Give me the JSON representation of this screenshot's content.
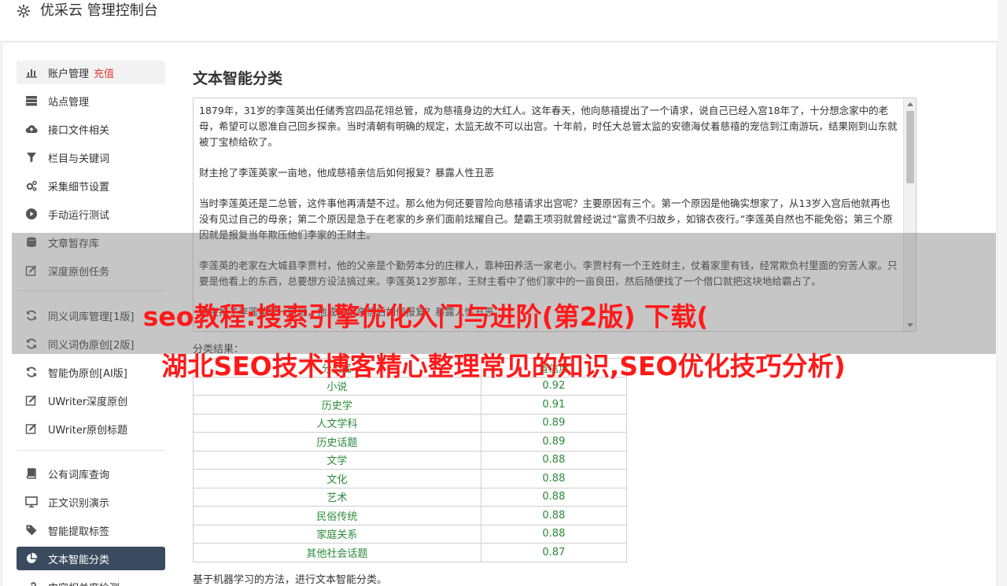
{
  "header": {
    "title": "优采云 管理控制台"
  },
  "sidebar": {
    "items": [
      {
        "label": "账户管理",
        "badge": "充值",
        "icon": "bar-chart-icon"
      },
      {
        "label": "站点管理",
        "icon": "server-icon"
      },
      {
        "label": "接口文件相关",
        "icon": "cloud-upload-icon"
      },
      {
        "label": "栏目与关键词",
        "icon": "filter-icon"
      },
      {
        "label": "采集细节设置",
        "icon": "gears-icon"
      },
      {
        "label": "手动运行测试",
        "icon": "play-circle-icon"
      },
      {
        "label": "文章暂存库",
        "icon": "database-icon"
      },
      {
        "label": "深度原创任务",
        "icon": "edit-icon"
      },
      {
        "label": "同义词库管理[1版]",
        "icon": "refresh-icon"
      },
      {
        "label": "同义词伪原创[2版]",
        "icon": "refresh-icon"
      },
      {
        "label": "智能伪原创[AI版]",
        "icon": "refresh-icon"
      },
      {
        "label": "UWriter深度原创",
        "icon": "edit-icon"
      },
      {
        "label": "UWriter原创标题",
        "icon": "edit-icon"
      },
      {
        "label": "公有词库查询",
        "icon": "book-icon"
      },
      {
        "label": "正文识别演示",
        "icon": "monitor-icon"
      },
      {
        "label": "智能提取标签",
        "icon": "tag-icon"
      },
      {
        "label": "文本智能分类",
        "icon": "pie-chart-icon"
      },
      {
        "label": "内容相关度检测",
        "icon": "link-icon"
      }
    ]
  },
  "main": {
    "title": "文本智能分类",
    "text_paragraphs": [
      "1879年，31岁的李莲英出任储秀宫四品花翎总管，成为慈禧身边的大红人。这年春天，他向慈禧提出了一个请求，说自己已经入宫18年了，十分想念家中的老母，希望可以恩准自己回乡探亲。当时清朝有明确的规定，太监无故不可以出宫。十年前，时任大总管太监的安德海仗着慈禧的宠信到江南游玩，结果刚到山东就被丁宝桢给砍了。",
      "财主抢了李莲英家一亩地，他成慈禧亲信后如何报复？暴露人性丑恶",
      "当时李莲英还是二总管，这件事他再清楚不过。那么他为何还要冒险向慈禧请求出宫呢？主要原因有三个。第一个原因是他确实想家了，从13岁入宫后他就再也没有见过自己的母亲；第二个原因是急于在老家的乡亲们面前炫耀自己。楚霸王项羽就曾经说过“富贵不归故乡，如锦衣夜行。”李莲英自然也不能免俗；第三个原因就是报复当年欺压他们李家的王财主。",
      "李莲英的老家在大城县李贾村，他的父亲是个勤劳本分的庄稼人，靠种田养活一家老小。李贾村有一个王姓财主，仗着家里有钱，经常欺负村里面的穷苦人家。只要是他看上的东西，总要想方设法搞过来。李莲英12岁那年，王财主看中了他们家中的一亩良田，然后随便找了一个借口就把这块地给霸占了。",
      "财主抢了李莲英家一亩地，他成慈禧亲信后如何报复？暴露人性丑恶"
    ],
    "result_label": "分类结果：",
    "table": {
      "headers": [
        "分类名",
        "置信度"
      ],
      "rows": [
        [
          "小说",
          "0.92"
        ],
        [
          "历史学",
          "0.91"
        ],
        [
          "人文学科",
          "0.89"
        ],
        [
          "历史话题",
          "0.89"
        ],
        [
          "文学",
          "0.88"
        ],
        [
          "文化",
          "0.88"
        ],
        [
          "艺术",
          "0.88"
        ],
        [
          "民俗传统",
          "0.88"
        ],
        [
          "家庭关系",
          "0.88"
        ],
        [
          "其他社会话题",
          "0.87"
        ]
      ]
    },
    "footnote": "基于机器学习的方法，进行文本智能分类。"
  },
  "overlay": {
    "line1": "seo教程:搜索引擎优化入门与进阶(第2版) 下载(",
    "line2": "湖北SEO技术博客精心整理常见的知识,SEO优化技巧分析)"
  },
  "colors": {
    "accent_active": "#3a4b5f",
    "recharge": "#e53935",
    "table_text": "#2a8a3a",
    "banner": "#ff1a1a"
  }
}
